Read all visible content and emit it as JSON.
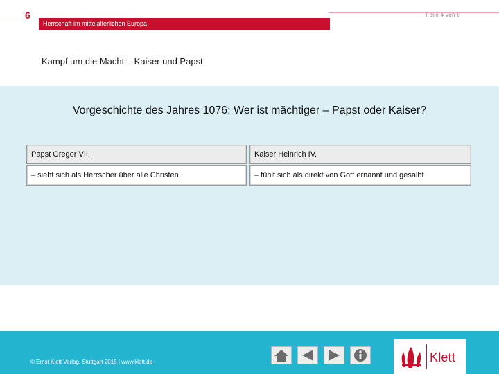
{
  "header": {
    "chapter_number": "6",
    "chapter_title": "Herrschaft im mittelalterlichen Europa",
    "slide_counter": "Folie 4 von 8"
  },
  "slide": {
    "heading": "Kampf um die Macht – Kaiser und Papst",
    "question": "Vorgeschichte des Jahres 1076: Wer ist mächtiger – Papst oder Kaiser?"
  },
  "table": {
    "headers": [
      "Papst Gregor VII.",
      "Kaiser Heinrich IV."
    ],
    "rows": [
      [
        "– sieht sich als Herrscher über alle Christen",
        "– fühlt sich als direkt von Gott ernannt und gesalbt"
      ]
    ]
  },
  "footer": {
    "copyright": "© Ernst Klett Verlag, Stuttgart 2015 | www.klett.de",
    "nav_buttons": [
      "home-icon",
      "back-icon",
      "forward-icon",
      "info-icon"
    ],
    "logo_text": "Klett"
  },
  "colors": {
    "accent_red": "#c8102e",
    "panel_blue": "#dbeff4",
    "footer_cyan": "#23b5cf"
  }
}
